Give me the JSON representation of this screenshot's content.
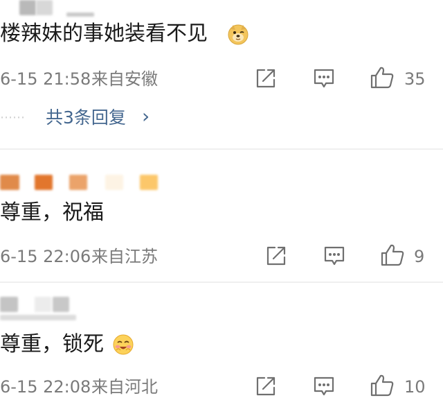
{
  "comments": [
    {
      "text": "楼辣妹的事她装看不见",
      "emoji": "doge-face-icon",
      "time": "6-15 21:58",
      "location": "来自安徽",
      "likes": "35",
      "replies_label": "共3条回复",
      "replies_chevron": "›",
      "replies_dots": "⋯⋯"
    },
    {
      "text": "尊重，祝福",
      "time": "6-15 22:06",
      "location": "来自江苏",
      "likes": "9"
    },
    {
      "text": "尊重，锁死",
      "emoji": "laughing-blush-icon",
      "time": "6-15 22:08",
      "location": "来自河北",
      "likes": "10"
    }
  ],
  "colors": {
    "meta_gray": "#7a7a7a",
    "link_blue": "#44678f",
    "divider": "#efefef"
  }
}
